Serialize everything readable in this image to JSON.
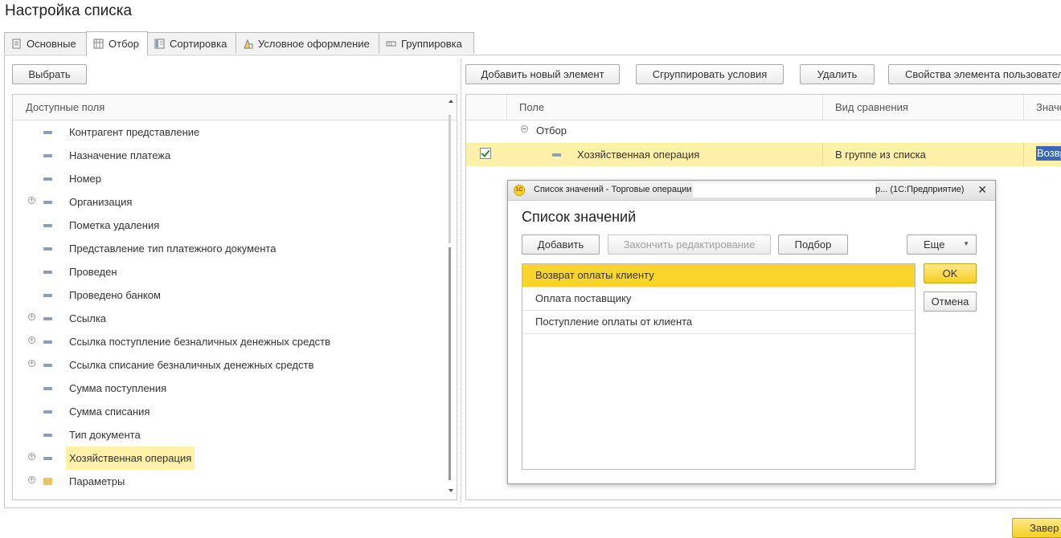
{
  "window": {
    "title": "Настройка списка"
  },
  "tabs": [
    {
      "label": "Основные",
      "icon": "document-icon",
      "active": false
    },
    {
      "label": "Отбор",
      "icon": "filter-icon",
      "active": true
    },
    {
      "label": "Сортировка",
      "icon": "sort-icon",
      "active": false
    },
    {
      "label": "Условное оформление",
      "icon": "conditional-format-icon",
      "active": false
    },
    {
      "label": "Группировка",
      "icon": "grouping-icon",
      "active": false
    }
  ],
  "left": {
    "select_button": "Выбрать",
    "fields_header": "Доступные поля",
    "fields": [
      {
        "label": "Контрагент представление",
        "expandable": false,
        "icon": "field-icon",
        "selected": false
      },
      {
        "label": "Назначение платежа",
        "expandable": false,
        "icon": "field-icon",
        "selected": false
      },
      {
        "label": "Номер",
        "expandable": false,
        "icon": "field-icon",
        "selected": false
      },
      {
        "label": "Организация",
        "expandable": true,
        "icon": "field-icon",
        "selected": false
      },
      {
        "label": "Пометка удаления",
        "expandable": false,
        "icon": "field-icon",
        "selected": false
      },
      {
        "label": "Представление тип платежного документа",
        "expandable": false,
        "icon": "field-icon",
        "selected": false
      },
      {
        "label": "Проведен",
        "expandable": false,
        "icon": "field-icon",
        "selected": false
      },
      {
        "label": "Проведено банком",
        "expandable": false,
        "icon": "field-icon",
        "selected": false
      },
      {
        "label": "Ссылка",
        "expandable": true,
        "icon": "field-icon",
        "selected": false
      },
      {
        "label": "Ссылка поступление безналичных денежных средств",
        "expandable": true,
        "icon": "field-icon",
        "selected": false
      },
      {
        "label": "Ссылка списание безналичных денежных средств",
        "expandable": true,
        "icon": "field-icon",
        "selected": false
      },
      {
        "label": "Сумма поступления",
        "expandable": false,
        "icon": "field-icon",
        "selected": false
      },
      {
        "label": "Сумма списания",
        "expandable": false,
        "icon": "field-icon",
        "selected": false
      },
      {
        "label": "Тип документа",
        "expandable": false,
        "icon": "field-icon",
        "selected": false
      },
      {
        "label": "Хозяйственная операция",
        "expandable": true,
        "icon": "field-icon",
        "selected": true
      },
      {
        "label": "Параметры",
        "expandable": true,
        "icon": "folder-icon",
        "selected": false
      }
    ]
  },
  "right": {
    "toolbar": {
      "add": "Добавить новый элемент",
      "group": "Сгруппировать условия",
      "delete": "Удалить",
      "properties": "Свойства элемента пользовател"
    },
    "columns": {
      "field": "Поле",
      "comparison": "Вид сравнения",
      "value": "Значе"
    },
    "group_node": "Отбор",
    "row": {
      "field": "Хозяйственная операция",
      "comparison": "В группе из списка",
      "value": "Возвр",
      "checked": true
    }
  },
  "dialog": {
    "title_left": "Список значений - Торговые операции",
    "title_right": "р... (1С:Предприятие)",
    "heading": "Список значений",
    "buttons": {
      "add": "Добавить",
      "finish": "Закончить редактирование",
      "pick": "Подбор",
      "more": "Еще",
      "ok": "OK",
      "cancel": "Отмена"
    },
    "values": [
      {
        "label": "Возврат оплаты клиенту",
        "selected": true
      },
      {
        "label": "Оплата поставщику",
        "selected": false
      },
      {
        "label": "Поступление оплаты от клиента",
        "selected": false
      }
    ]
  },
  "footer": {
    "finish_button": "Завер"
  }
}
